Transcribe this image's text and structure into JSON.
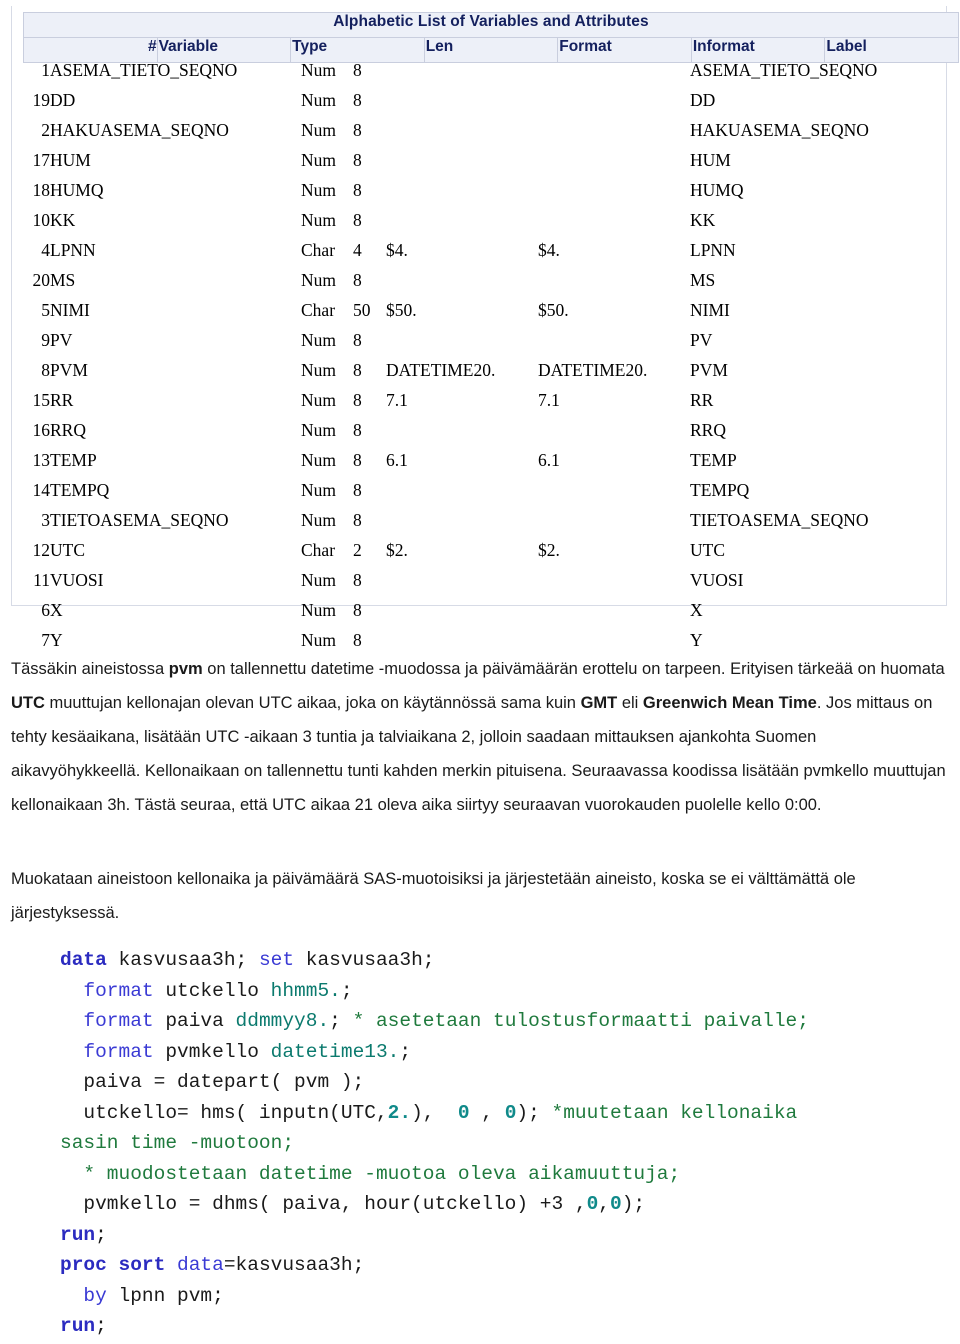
{
  "table": {
    "title": "Alphabetic List of Variables and Attributes",
    "headers": [
      "#",
      "Variable",
      "Type",
      "Len",
      "Format",
      "Informat",
      "Label"
    ],
    "rows": [
      {
        "num": "1",
        "variable": "ASEMA_TIETO_SEQNO",
        "type": "Num",
        "len": "8",
        "format": "",
        "informat": "",
        "label": "ASEMA_TIETO_SEQNO"
      },
      {
        "num": "19",
        "variable": "DD",
        "type": "Num",
        "len": "8",
        "format": "",
        "informat": "",
        "label": "DD"
      },
      {
        "num": "2",
        "variable": "HAKUASEMA_SEQNO",
        "type": "Num",
        "len": "8",
        "format": "",
        "informat": "",
        "label": "HAKUASEMA_SEQNO"
      },
      {
        "num": "17",
        "variable": "HUM",
        "type": "Num",
        "len": "8",
        "format": "",
        "informat": "",
        "label": "HUM"
      },
      {
        "num": "18",
        "variable": "HUMQ",
        "type": "Num",
        "len": "8",
        "format": "",
        "informat": "",
        "label": "HUMQ"
      },
      {
        "num": "10",
        "variable": "KK",
        "type": "Num",
        "len": "8",
        "format": "",
        "informat": "",
        "label": "KK"
      },
      {
        "num": "4",
        "variable": "LPNN",
        "type": "Char",
        "len": "4",
        "format": "$4.",
        "informat": "$4.",
        "label": "LPNN"
      },
      {
        "num": "20",
        "variable": "MS",
        "type": "Num",
        "len": "8",
        "format": "",
        "informat": "",
        "label": "MS"
      },
      {
        "num": "5",
        "variable": "NIMI",
        "type": "Char",
        "len": "50",
        "format": "$50.",
        "informat": "$50.",
        "label": "NIMI"
      },
      {
        "num": "9",
        "variable": "PV",
        "type": "Num",
        "len": "8",
        "format": "",
        "informat": "",
        "label": "PV"
      },
      {
        "num": "8",
        "variable": "PVM",
        "type": "Num",
        "len": "8",
        "format": "DATETIME20.",
        "informat": "DATETIME20.",
        "label": "PVM"
      },
      {
        "num": "15",
        "variable": "RR",
        "type": "Num",
        "len": "8",
        "format": "7.1",
        "informat": "7.1",
        "label": "RR"
      },
      {
        "num": "16",
        "variable": "RRQ",
        "type": "Num",
        "len": "8",
        "format": "",
        "informat": "",
        "label": "RRQ"
      },
      {
        "num": "13",
        "variable": "TEMP",
        "type": "Num",
        "len": "8",
        "format": "6.1",
        "informat": "6.1",
        "label": "TEMP"
      },
      {
        "num": "14",
        "variable": "TEMPQ",
        "type": "Num",
        "len": "8",
        "format": "",
        "informat": "",
        "label": "TEMPQ"
      },
      {
        "num": "3",
        "variable": "TIETOASEMA_SEQNO",
        "type": "Num",
        "len": "8",
        "format": "",
        "informat": "",
        "label": "TIETOASEMA_SEQNO"
      },
      {
        "num": "12",
        "variable": "UTC",
        "type": "Char",
        "len": "2",
        "format": "$2.",
        "informat": "$2.",
        "label": "UTC"
      },
      {
        "num": "11",
        "variable": "VUOSI",
        "type": "Num",
        "len": "8",
        "format": "",
        "informat": "",
        "label": "VUOSI"
      },
      {
        "num": "6",
        "variable": "X",
        "type": "Num",
        "len": "8",
        "format": "",
        "informat": "",
        "label": "X"
      },
      {
        "num": "7",
        "variable": "Y",
        "type": "Num",
        "len": "8",
        "format": "",
        "informat": "",
        "label": "Y"
      }
    ]
  },
  "paragraphs": {
    "p1": {
      "s1": "Tässäkin aineistossa ",
      "b1": "pvm",
      "s2": " on tallennettu datetime -muodossa ja päivämäärän erottelu on tarpeen. Erityisen tärkeää on huomata ",
      "b2": "UTC",
      "s3": " muuttujan kellonajan olevan UTC aikaa, joka on käytännössä sama kuin ",
      "b3": "GMT",
      "s4": " eli ",
      "b4": "Greenwich Mean Time",
      "s5": ". Jos mittaus on tehty kesäaikana, lisätään UTC -aikaan 3 tuntia ja talviaikana 2, jolloin saadaan mittauksen ajankohta Suomen aikavyöhykkeellä. Kellonaikaan on tallennettu tunti kahden merkin pituisena. Seuraavassa koodissa lisätään pvmkello muuttujan kellonaikaan 3h. Tästä seuraa, että UTC aikaa 21 oleva aika siirtyy seuraavan vuorokauden puolelle kello 0:00."
    },
    "p2": "Muokataan aineistoon kellonaika ja päivämäärä SAS-muotoisiksi ja järjestetään aineisto, koska se ei välttämättä ole järjestyksessä."
  },
  "code": {
    "lines": [
      [
        {
          "t": "data",
          "c": "kw"
        },
        {
          "t": " kasvusaa3h; ",
          "c": "plain"
        },
        {
          "t": "set",
          "c": "kw2"
        },
        {
          "t": " kasvusaa3h;",
          "c": "plain"
        }
      ],
      [
        {
          "t": "  ",
          "c": "plain"
        },
        {
          "t": "format",
          "c": "kw2"
        },
        {
          "t": " utckello ",
          "c": "plain"
        },
        {
          "t": "hhmm5.",
          "c": "fmtn"
        },
        {
          "t": ";",
          "c": "plain"
        }
      ],
      [
        {
          "t": "  ",
          "c": "plain"
        },
        {
          "t": "format",
          "c": "kw2"
        },
        {
          "t": " paiva ",
          "c": "plain"
        },
        {
          "t": "ddmmyy8.",
          "c": "fmtn"
        },
        {
          "t": "; ",
          "c": "plain"
        },
        {
          "t": "* asetetaan tulostusformaatti paivalle;",
          "c": "cmt"
        }
      ],
      [
        {
          "t": "  ",
          "c": "plain"
        },
        {
          "t": "format",
          "c": "kw2"
        },
        {
          "t": " pvmkello ",
          "c": "plain"
        },
        {
          "t": "datetime13.",
          "c": "fmtn"
        },
        {
          "t": ";",
          "c": "plain"
        }
      ],
      [
        {
          "t": "  paiva = datepart( pvm );",
          "c": "plain"
        }
      ],
      [
        {
          "t": "  utckello= hms( inputn(UTC,",
          "c": "plain"
        },
        {
          "t": "2.",
          "c": "numlit"
        },
        {
          "t": "),  ",
          "c": "plain"
        },
        {
          "t": "0",
          "c": "numlit"
        },
        {
          "t": " , ",
          "c": "plain"
        },
        {
          "t": "0",
          "c": "numlit"
        },
        {
          "t": "); ",
          "c": "plain"
        },
        {
          "t": "*muutetaan kellonaika",
          "c": "cmt"
        }
      ],
      [
        {
          "t": "sasin time -muotoon;",
          "c": "cmt"
        }
      ],
      [
        {
          "t": "  ",
          "c": "plain"
        },
        {
          "t": "* muodostetaan datetime -muotoa oleva aikamuuttuja;",
          "c": "cmt"
        }
      ],
      [
        {
          "t": "  pvmkello = dhms( paiva, hour(utckello) +3 ,",
          "c": "plain"
        },
        {
          "t": "0",
          "c": "numlit"
        },
        {
          "t": ",",
          "c": "plain"
        },
        {
          "t": "0",
          "c": "numlit"
        },
        {
          "t": ");",
          "c": "plain"
        }
      ],
      [
        {
          "t": "run",
          "c": "kw"
        },
        {
          "t": ";",
          "c": "plain"
        }
      ],
      [
        {
          "t": "proc sort",
          "c": "kw"
        },
        {
          "t": " ",
          "c": "plain"
        },
        {
          "t": "data",
          "c": "kw2"
        },
        {
          "t": "=kasvusaa3h;",
          "c": "plain"
        }
      ],
      [
        {
          "t": "  ",
          "c": "plain"
        },
        {
          "t": "by",
          "c": "kw2"
        },
        {
          "t": " lpnn pvm;",
          "c": "plain"
        }
      ],
      [
        {
          "t": "run",
          "c": "kw"
        },
        {
          "t": ";",
          "c": "plain"
        }
      ]
    ]
  },
  "colors": {
    "header_bg": "#edf0f8",
    "header_text": "#14205e",
    "border": "#c9cede",
    "keyword": "#2b2bc0",
    "format_name": "#0b7a6e",
    "comment": "#1f7a3d",
    "numeric_literal": "#108a8a"
  }
}
